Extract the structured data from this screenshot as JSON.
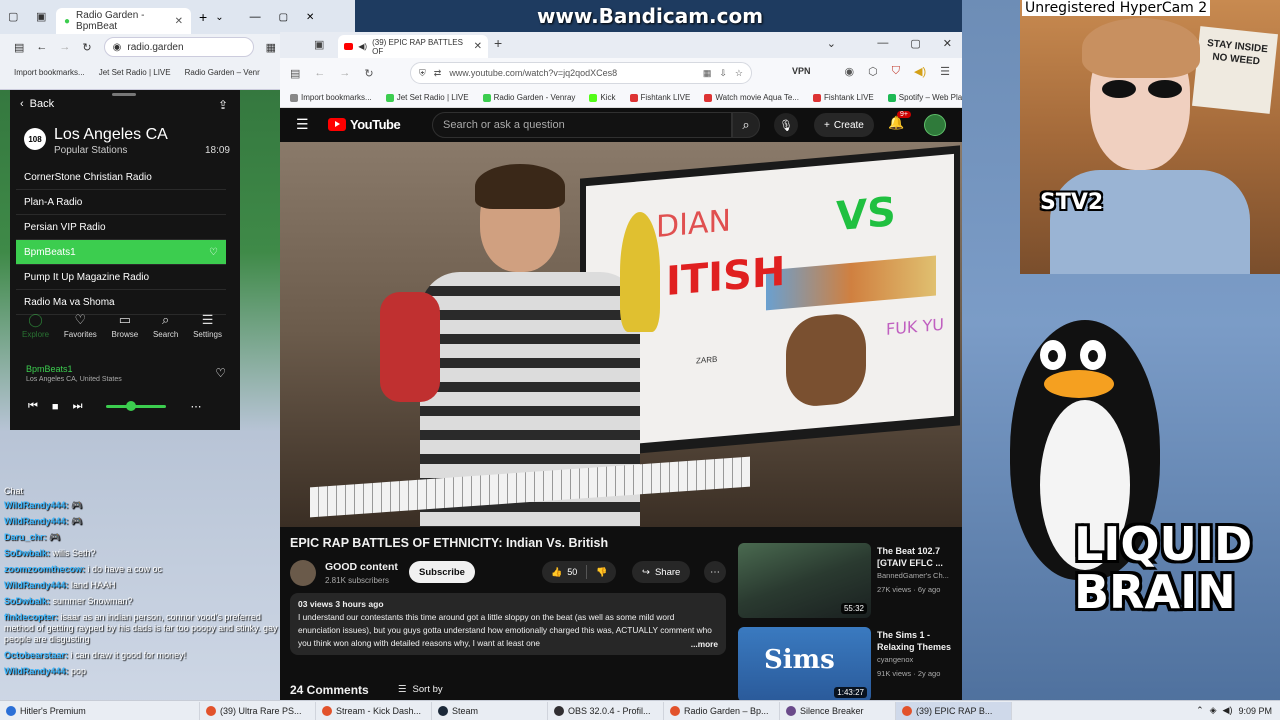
{
  "overlay": {
    "bandicam": "www.Bandicam.com",
    "hypercam": "Unregistered HyperCam 2"
  },
  "left_browser": {
    "tab_label": "Radio Garden - BpmBeat",
    "url": "radio.garden",
    "bookmarks": [
      "Import bookmarks...",
      "Jet Set Radio | LIVE",
      "Radio Garden – Venr"
    ]
  },
  "radio": {
    "back": "Back",
    "badge": "108",
    "city": "Los Angeles CA",
    "popular": "Popular Stations",
    "time": "18:09",
    "stations": [
      "CornerStone Christian Radio",
      "Plan-A Radio",
      "Persian VIP Radio",
      "BpmBeats1",
      "Pump It Up Magazine Radio",
      "Radio Ma va Shoma"
    ],
    "active_index": 3,
    "nav": [
      {
        "icon": "◯",
        "label": "Explore"
      },
      {
        "icon": "♡",
        "label": "Favorites"
      },
      {
        "icon": "▭",
        "label": "Browse"
      },
      {
        "icon": "⌕",
        "label": "Search"
      },
      {
        "icon": "☰",
        "label": "Settings"
      }
    ],
    "now_playing": "BpmBeats1",
    "now_location": "Los Angeles CA, United States"
  },
  "chat": {
    "header": "Chat",
    "lines": [
      {
        "user": "WildRandy444:",
        "text": "🎮"
      },
      {
        "user": "WildRandy444:",
        "text": "🎮"
      },
      {
        "user": "Daru_chr:",
        "text": "🎮"
      },
      {
        "user": "SoDwbalk:",
        "text": "wilis Seth?"
      },
      {
        "user": "zoomzoomthecow:",
        "text": "i do have a cow oc"
      },
      {
        "user": "WildRandy444:",
        "text": "land HAAH"
      },
      {
        "user": "SoDwbalk:",
        "text": "summer Snowman?"
      },
      {
        "user": "finklecopter:",
        "text": "isaar as an indian person, connor vood's preferred method of getting rayped by his dads is far too poopy and stinky. gay people are disgusting"
      },
      {
        "user": "Octobearstaar:",
        "text": "i can draw it good for money!"
      },
      {
        "user": "WildRandy444:",
        "text": "pop"
      }
    ]
  },
  "browser": {
    "tab_label": "(39) EPIC RAP BATTLES OF",
    "url": "www.youtube.com/watch?v=jq2qodXCes8",
    "vpn": "VPN",
    "bookmarks": [
      "Import bookmarks...",
      "Jet Set Radio | LIVE",
      "Radio Garden - Venray",
      "Kick",
      "Fishtank LIVE",
      "Watch movie Aqua Te...",
      "Fishtank LIVE",
      "Spotify – Web Player"
    ]
  },
  "youtube": {
    "logo": "YouTube",
    "search_placeholder": "Search or ask a question",
    "create": "Create",
    "notif_count": "9+",
    "video_title": "EPIC RAP BATTLES OF ETHNICITY: Indian Vs. British",
    "channel": "GOOD content",
    "subscribers": "2.81K subscribers",
    "subscribe": "Subscribe",
    "likes": "50",
    "share": "Share",
    "views": "03 views  3 hours ago",
    "description": "I understand our contestants this time around got a little sloppy on the beat (as well as some mild word enunciation issues), but you guys gotta understand how emotionally charged this was, ACTUALLY comment who you think won along with detailed reasons why, I want at least one",
    "more": "...more",
    "comments": "24 Comments",
    "sort_by": "Sort by",
    "video_overlay": {
      "line1": "DIAN",
      "line2": "ITISH",
      "vs": "VS",
      "fuk": "FUK YU",
      "sign": "ZARB"
    }
  },
  "recommendations": [
    {
      "title": "The Beat 102.7 [GTAIV EFLC ...",
      "channel": "BannedGamer's Ch...",
      "meta": "27K views · 6y ago",
      "duration": "55:32"
    },
    {
      "title": "The Sims 1 - Relaxing Themes",
      "channel": "cyangenox",
      "meta": "91K views · 2y ago",
      "duration": "1:43:27"
    }
  ],
  "webcam": {
    "sign": "STAY INSIDE NO WEED",
    "logo": "STV2"
  },
  "stream_logo": [
    "LIQUID",
    "BRAIN"
  ],
  "taskbar": {
    "items": [
      {
        "label": "(39) Ultra Rare PS...",
        "color": "#e2522b"
      },
      {
        "label": "Stream - Kick Dash...",
        "color": "#e2522b"
      },
      {
        "label": "Steam",
        "color": "#1b2838"
      },
      {
        "label": "OBS 32.0.4 - Profil...",
        "color": "#302e31"
      },
      {
        "label": "Radio Garden – Bp...",
        "color": "#e2522b"
      },
      {
        "label": "Silence Breaker",
        "color": "#6a4a8a"
      },
      {
        "label": "(39) EPIC RAP B...",
        "color": "#e2522b"
      }
    ],
    "first_label": "Hitler's Premium",
    "time": "9:09 PM"
  },
  "colors": {
    "radio_green": "#3ccd4f",
    "yt_red": "#ff0000",
    "yt_bg": "#0f0f0f"
  }
}
